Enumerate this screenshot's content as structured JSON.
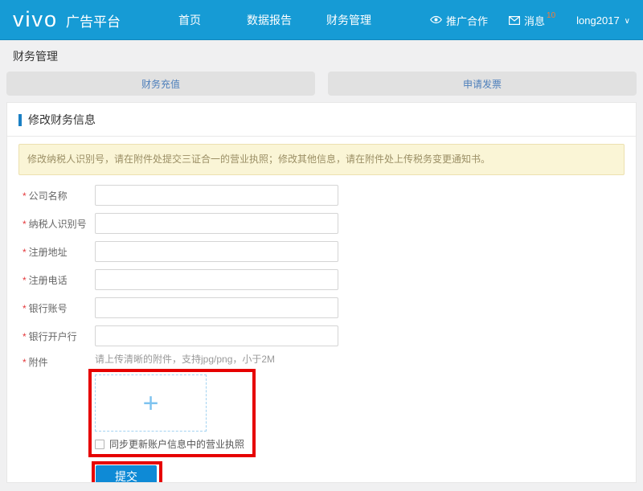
{
  "header": {
    "logo": "vivo",
    "logo_suffix": "广告平台",
    "nav": [
      {
        "label": "首页"
      },
      {
        "label": "数据报告"
      },
      {
        "label": "财务管理"
      }
    ],
    "right": {
      "promo_label": "推广合作",
      "messages_label": "消息",
      "messages_count": "10",
      "username": "long2017",
      "caret": "∨"
    }
  },
  "page": {
    "title": "财务管理",
    "tabs": [
      {
        "label": "财务充值"
      },
      {
        "label": "申请发票"
      }
    ]
  },
  "panel": {
    "section_title": "修改财务信息",
    "notice": "修改纳税人识别号，请在附件处提交三证合一的营业执照；修改其他信息，请在附件处上传税务变更通知书。",
    "required_mark": "*",
    "fields": [
      {
        "label": "公司名称",
        "value": "",
        "required": true
      },
      {
        "label": "纳税人识别号",
        "value": "",
        "required": true
      },
      {
        "label": "注册地址",
        "value": "",
        "required": true
      },
      {
        "label": "注册电话",
        "value": "",
        "required": true
      },
      {
        "label": "银行账号",
        "value": "",
        "required": true
      },
      {
        "label": "银行开户行",
        "value": "",
        "required": true
      }
    ],
    "attachment": {
      "label": "附件",
      "required": true,
      "hint": "请上传清晰的附件，支持jpg/png，小于2M",
      "plus_glyph": "+",
      "checkbox_label": "同步更新账户信息中的营业执照",
      "checkbox_checked": false
    },
    "submit_label": "提交"
  },
  "icons": {
    "promo": "eye-icon",
    "messages": "mail-icon",
    "user": "chevron-down-icon",
    "upload": "plus-icon"
  },
  "colors": {
    "header_bg": "#169bd5",
    "accent_blue": "#0e8ad6",
    "annotation_red": "#e60000",
    "tab_text": "#4d7fbb",
    "notice_bg": "#faf5d6",
    "badge_orange": "#f87a36"
  }
}
